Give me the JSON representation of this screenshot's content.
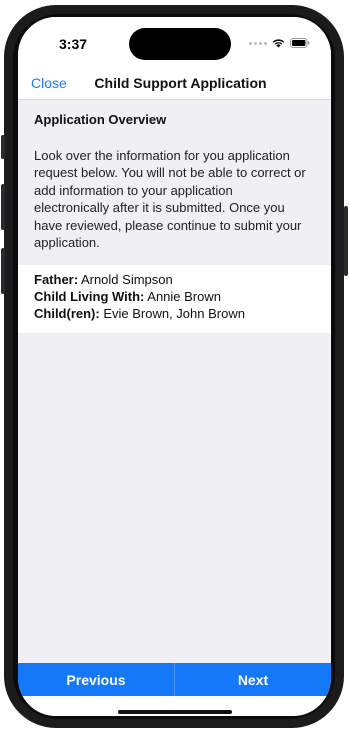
{
  "status_bar": {
    "time": "3:37",
    "icons": [
      "signal-dots-icon",
      "wifi-icon",
      "battery-icon"
    ]
  },
  "nav": {
    "close_label": "Close",
    "title": "Child Support Application"
  },
  "overview": {
    "heading": "Application Overview",
    "lines": [
      "Look over the information for you application",
      "request below. You will not be able to correct or",
      "add information to your application",
      "electronically after it is submitted. Once you",
      "have reviewed, please continue to submit your",
      "application."
    ]
  },
  "details": {
    "father_label": "Father:",
    "father_value": " Arnold Simpson",
    "living_label": "Child Living With:",
    "living_value": " Annie Brown",
    "children_label": "Child(ren):",
    "children_value": " Evie Brown, John Brown"
  },
  "footer": {
    "previous_label": "Previous",
    "next_label": "Next"
  },
  "colors": {
    "accent": "#1478f9",
    "link": "#1a7cf6",
    "background": "#efeff4",
    "frame": "#1b1b1d"
  }
}
